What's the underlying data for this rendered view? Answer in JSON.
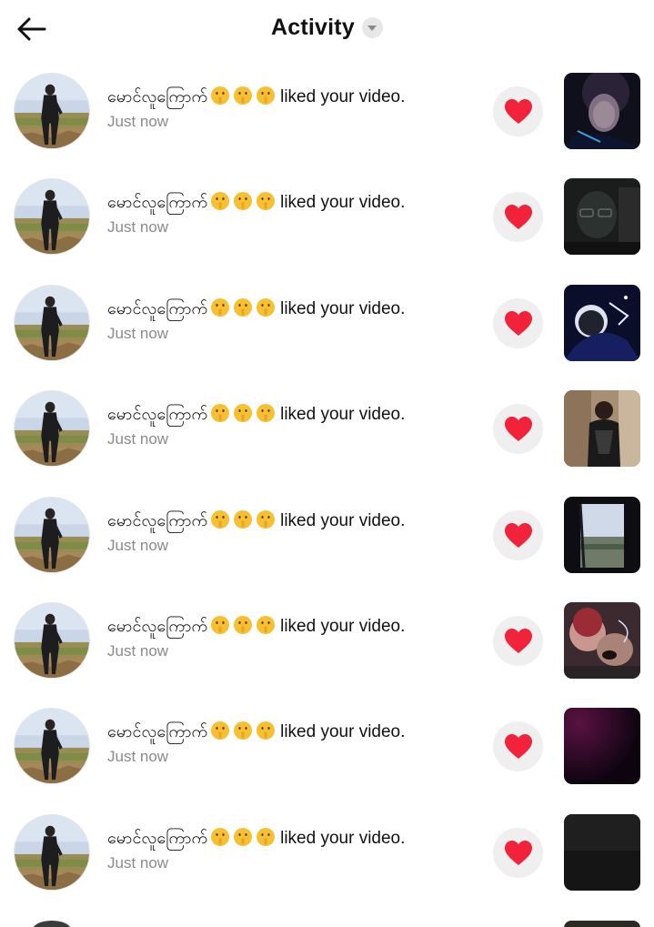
{
  "header": {
    "title": "Activity",
    "back_icon": "arrow-left-icon",
    "caret_icon": "caret-down-icon"
  },
  "notifications": [
    {
      "username": "မောင်လူကြောက်",
      "emojis": [
        "shushing-face",
        "shushing-face",
        "shushing-face"
      ],
      "action": "liked your video.",
      "time": "Just now",
      "liked": true,
      "thumb_style": "dark-face-blue"
    },
    {
      "username": "မောင်လူကြောက်",
      "emojis": [
        "shushing-face",
        "shushing-face",
        "shushing-face"
      ],
      "action": "liked your video.",
      "time": "Just now",
      "liked": true,
      "thumb_style": "dark-glasses"
    },
    {
      "username": "မောင်လူကြောက်",
      "emojis": [
        "shushing-face",
        "shushing-face",
        "shushing-face"
      ],
      "action": "liked your video.",
      "time": "Just now",
      "liked": true,
      "thumb_style": "night-blue"
    },
    {
      "username": "မောင်လူကြောက်",
      "emojis": [
        "shushing-face",
        "shushing-face",
        "shushing-face"
      ],
      "action": "liked your video.",
      "time": "Just now",
      "liked": true,
      "thumb_style": "room-person"
    },
    {
      "username": "မောင်လူကြောက်",
      "emojis": [
        "shushing-face",
        "shushing-face",
        "shushing-face"
      ],
      "action": "liked your video.",
      "time": "Just now",
      "liked": true,
      "thumb_style": "window-view"
    },
    {
      "username": "မောင်လူကြောက်",
      "emojis": [
        "shushing-face",
        "shushing-face",
        "shushing-face"
      ],
      "action": "liked your video.",
      "time": "Just now",
      "liked": true,
      "thumb_style": "faces-red"
    },
    {
      "username": "မောင်လူကြောက်",
      "emojis": [
        "shushing-face",
        "shushing-face",
        "shushing-face"
      ],
      "action": "liked your video.",
      "time": "Just now",
      "liked": true,
      "thumb_style": "purple-dark"
    },
    {
      "username": "မောင်လူကြောက်",
      "emojis": [
        "shushing-face",
        "shushing-face",
        "shushing-face"
      ],
      "action": "liked your video.",
      "time": "Just now",
      "liked": true,
      "thumb_style": "black"
    }
  ],
  "colors": {
    "heart": "#f1223a",
    "like_bg": "#efefef",
    "time": "#8a8a8a",
    "emoji": "#f6c032"
  }
}
